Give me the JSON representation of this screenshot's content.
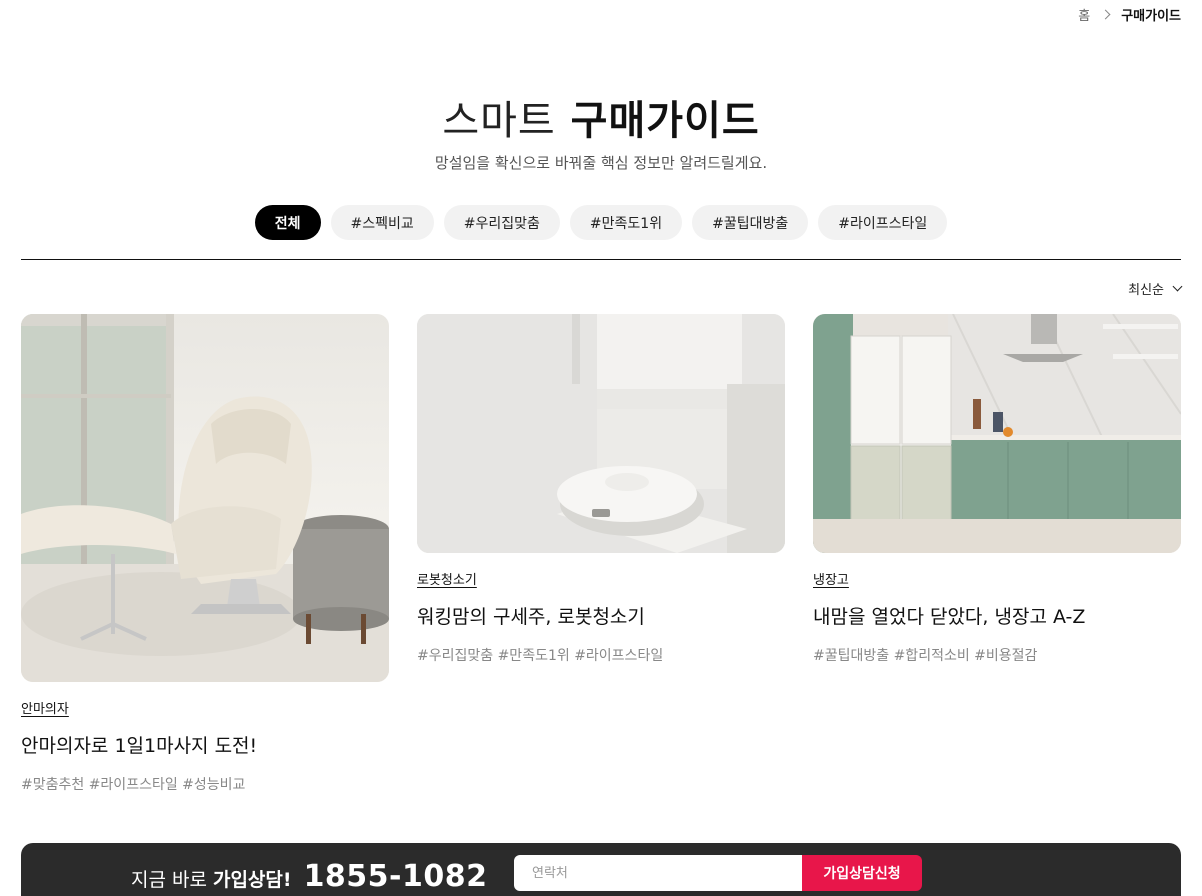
{
  "breadcrumb": {
    "home": "홈",
    "current": "구매가이드"
  },
  "header": {
    "title_light": "스마트",
    "title_bold": "구매가이드",
    "subtitle": "망설임을 확신으로 바꿔줄 핵심 정보만 알려드릴게요."
  },
  "filters": {
    "tags": [
      {
        "label": "전체",
        "active": true
      },
      {
        "label": "#스펙비교"
      },
      {
        "label": "#우리집맞춤"
      },
      {
        "label": "#만족도1위"
      },
      {
        "label": "#꿀팁대방출"
      },
      {
        "label": "#라이프스타일"
      }
    ]
  },
  "sort": {
    "label": "최신순"
  },
  "cards": [
    {
      "category": "안마의자",
      "title": "안마의자로 1일1마사지 도전!",
      "hashtags": "#맞춤추천 #라이프스타일 #성능비교"
    },
    {
      "category": "로봇청소기",
      "title": "워킹맘의 구세주, 로봇청소기",
      "hashtags": "#우리집맞춤 #만족도1위 #라이프스타일"
    },
    {
      "category": "냉장고",
      "title": "내맘을 열었다 닫았다, 냉장고 A-Z",
      "hashtags": "#꿀팁대방출 #합리적소비 #비용절감"
    }
  ],
  "banner": {
    "lead_text": "지금 바로",
    "lead_strong": "가입상담!",
    "phone": "1855-1082",
    "input_placeholder": "연락처",
    "button_label": "가입상담신청"
  }
}
